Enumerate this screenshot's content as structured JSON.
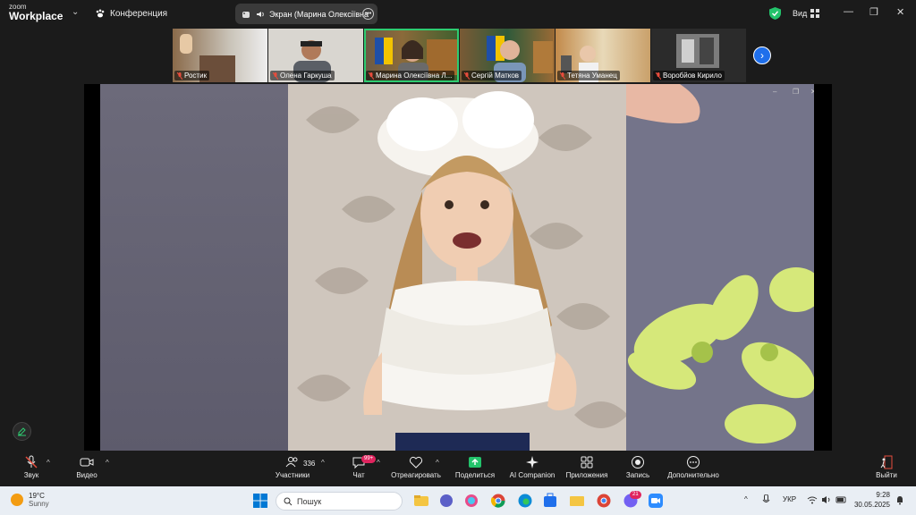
{
  "titlebar": {
    "logo_top": "zoom",
    "logo_bottom": "Workplace",
    "meeting_label": "Конференция",
    "share_label": "Экран (Марина Олексіївна",
    "view_label": "Вид"
  },
  "participants": [
    {
      "name": "Ростик",
      "muted": true,
      "active": false
    },
    {
      "name": "Олена Гаркуша",
      "muted": true,
      "active": false
    },
    {
      "name": "Марина Олексіївна Л...",
      "muted": true,
      "active": true
    },
    {
      "name": "Сергій Матков",
      "muted": true,
      "active": false
    },
    {
      "name": "Тетяна Уманец",
      "muted": true,
      "active": false
    },
    {
      "name": "Воробйов Кирило",
      "muted": true,
      "active": false
    }
  ],
  "toolbar": {
    "audio_label": "Звук",
    "video_label": "Видео",
    "participants_label": "Участники",
    "participants_count": "336",
    "chat_label": "Чат",
    "chat_badge": "99+",
    "react_label": "Отреагировать",
    "share_label": "Поделиться",
    "ai_label": "AI Companion",
    "apps_label": "Приложения",
    "record_label": "Запись",
    "more_label": "Дополнительно",
    "leave_label": "Выйти"
  },
  "taskbar": {
    "temp": "19°C",
    "weather": "Sunny",
    "search_placeholder": "Пошук",
    "lang": "УКР",
    "time": "9:28",
    "date": "30.05.2025",
    "mail_badge": "21"
  },
  "colors": {
    "accent_green": "#2ecc71",
    "share_green": "#23c36b",
    "badge_red": "#e0245e",
    "nav_blue": "#1f6feb"
  }
}
